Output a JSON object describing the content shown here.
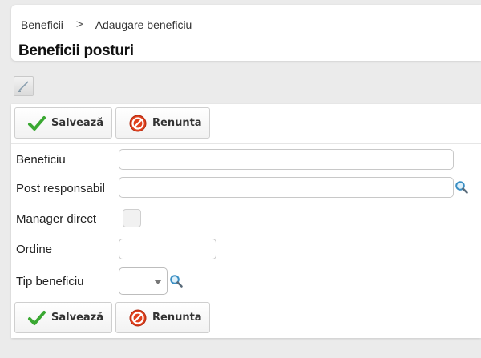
{
  "breadcrumb": {
    "parent": "Beneficii",
    "separator": ">",
    "current": "Adaugare beneficiu"
  },
  "page": {
    "title": "Beneficii posturi"
  },
  "toolbar": {
    "edit_icon": "edit-pencil-icon"
  },
  "actions": {
    "save_label": "Salvează",
    "cancel_label": "Renunta",
    "save_icon": "checkmark-icon",
    "cancel_icon": "cancel-circle-icon"
  },
  "form": {
    "beneficiu": {
      "label": "Beneficiu",
      "value": ""
    },
    "post_responsabil": {
      "label": "Post responsabil",
      "value": "",
      "lookup_icon": "search-icon"
    },
    "manager_direct": {
      "label": "Manager direct",
      "checked": false
    },
    "ordine": {
      "label": "Ordine",
      "value": ""
    },
    "tip_beneficiu": {
      "label": "Tip beneficiu",
      "selected": "",
      "lookup_icon": "search-icon"
    }
  },
  "colors": {
    "save_check": "#3aa832",
    "cancel_red": "#e0401d",
    "background": "#ebebeb"
  }
}
